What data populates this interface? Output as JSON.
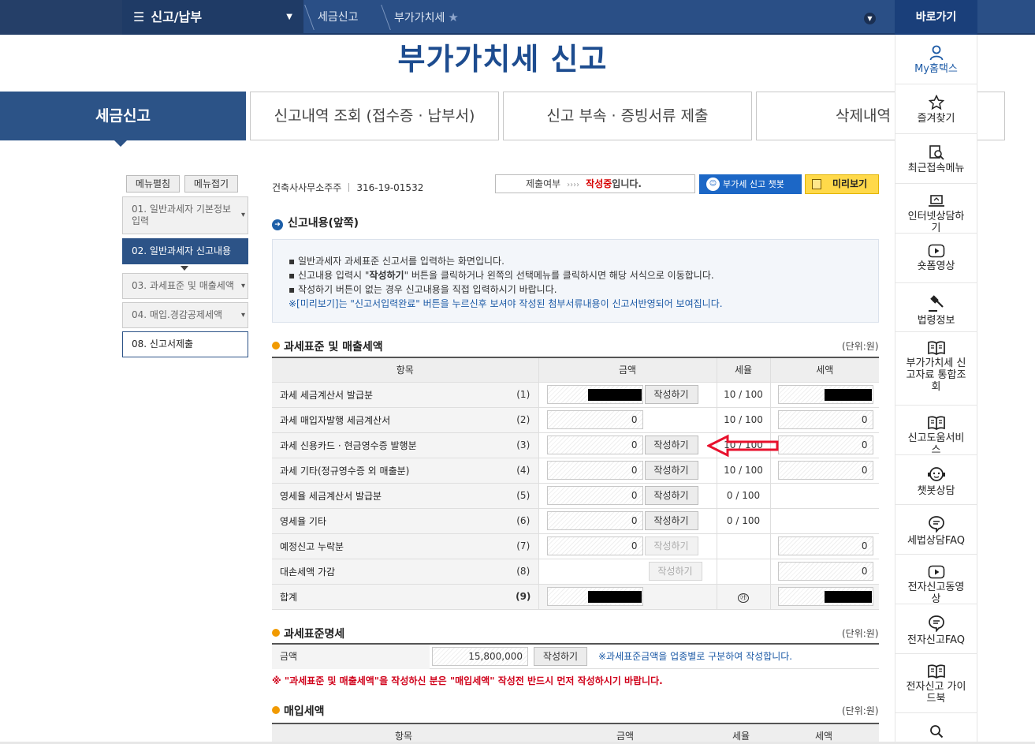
{
  "topbar": {
    "menu_label": "신고/납부",
    "breadcrumb": [
      "세금신고",
      "부가가치세"
    ],
    "quick_title": "바로가기"
  },
  "page_title": "부가가치세 신고",
  "tabs": [
    "세금신고",
    "신고내역 조회 (접수증 · 납부서)",
    "신고 부속 · 증빙서류 제출",
    "삭제내역"
  ],
  "sidebar": {
    "expand_label": "메뉴펼침",
    "collapse_label": "메뉴접기",
    "items": [
      {
        "label": "01. 일반과세자 기본정보 입력"
      },
      {
        "label": "02. 일반과세자 신고내용"
      },
      {
        "label": "03. 과세표준 및 매출세액"
      },
      {
        "label": "04. 매입.경감공제세액"
      },
      {
        "label": "08. 신고서제출"
      }
    ]
  },
  "business": {
    "name": "건축사사무소주주",
    "reg_no": "316-19-01532"
  },
  "status": {
    "label": "제출여부",
    "arrows": "››››",
    "value": "작성중",
    "suffix": "입니다."
  },
  "buttons": {
    "chatbot": "부가세 신고 챗봇",
    "preview": "미리보기",
    "write": "작성하기"
  },
  "section": {
    "title": "신고내용(앞쪽)",
    "info_lines": [
      "▪ 일반과세자 과세표준 신고서를 입력하는 화면입니다.",
      "▪ 신고내용 입력시 \"",
      "작성하기",
      "\" 버튼을 클릭하거나 왼쪽의 선택메뉴를 클릭하시면 해당 서식으로 이동합니다.",
      "▪ 작성하기 버튼이 없는 경우 신고내용을 직접 입력하시기 바랍니다.",
      "※[미리보기]는 \"신고서입력완료\" 버튼을 누르신후 보셔야 작성된 첨부서류내용이 신고서반영되어 보여집니다."
    ]
  },
  "sales": {
    "title": "과세표준 및 매출세액",
    "unit": "(단위:원)",
    "headers": [
      "항목",
      "금액",
      "세율",
      "세액"
    ],
    "rows": [
      {
        "label": "과세 세금계산서 발급분",
        "num": "(1)",
        "amount": "",
        "masked": true,
        "write": "active",
        "rate": "10 / 100",
        "tax": "",
        "tax_masked": true
      },
      {
        "label": "과세 매입자발행 세금계산서",
        "num": "(2)",
        "amount": "0",
        "masked": false,
        "write": "none",
        "rate": "10 / 100",
        "tax": "0",
        "tax_masked": false
      },
      {
        "label": "과세 신용카드 · 현금영수증 발행분",
        "num": "(3)",
        "amount": "0",
        "masked": false,
        "write": "active",
        "rate": "10 / 100",
        "tax": "0",
        "tax_masked": false
      },
      {
        "label": "과세 기타(정규영수증 외 매출분)",
        "num": "(4)",
        "amount": "0",
        "masked": false,
        "write": "active",
        "rate": "10 / 100",
        "tax": "0",
        "tax_masked": false
      },
      {
        "label": "영세율 세금계산서 발급분",
        "num": "(5)",
        "amount": "0",
        "masked": false,
        "write": "active",
        "rate": "0 / 100",
        "tax": "",
        "tax_masked": false,
        "no_tax": true
      },
      {
        "label": "영세율 기타",
        "num": "(6)",
        "amount": "0",
        "masked": false,
        "write": "active",
        "rate": "0 / 100",
        "tax": "",
        "tax_masked": false,
        "no_tax": true
      },
      {
        "label": "예정신고 누락분",
        "num": "(7)",
        "amount": "0",
        "masked": false,
        "write": "disabled",
        "rate": "",
        "tax": "0",
        "tax_masked": false
      },
      {
        "label": "대손세액 가감",
        "num": "(8)",
        "amount": "",
        "masked": false,
        "no_amount": true,
        "write": "disabled",
        "rate": "",
        "tax": "0",
        "tax_masked": false
      }
    ],
    "total": {
      "label": "합계",
      "num": "(9)",
      "rate_symbol": "㉮"
    }
  },
  "base": {
    "title": "과세표준명세",
    "unit": "(단위:원)",
    "label": "금액",
    "amount": "15,800,000",
    "note": "※과세표준금액을 업종별로 구분하여 작성합니다.",
    "warning": "※ \"과세표준 및 매출세액\"을 작성하신 분은 \"매입세액\" 작성전 반드시 먼저 작성하시기 바랍니다."
  },
  "purchase": {
    "title": "매입세액",
    "unit": "(단위:원)",
    "headers": [
      "항목",
      "금액",
      "세율",
      "세액"
    ]
  },
  "quick_menu": [
    {
      "label": "My홈택스",
      "icon": "person-icon"
    },
    {
      "label": "즐겨찾기",
      "icon": "star-icon"
    },
    {
      "label": "최근접속메뉴",
      "icon": "recent-icon"
    },
    {
      "label": "인터넷상담하기",
      "icon": "laptop-icon"
    },
    {
      "label": "숏폼영상",
      "icon": "play-icon"
    },
    {
      "label": "법령정보",
      "icon": "gavel-icon"
    },
    {
      "label": "부가가치세 신고자료 통합조회",
      "icon": "book-icon"
    },
    {
      "label": "신고도움서비스",
      "icon": "book-icon"
    },
    {
      "label": "챗봇상담",
      "icon": "chatbot-icon"
    },
    {
      "label": "세법상담FAQ",
      "icon": "speech-icon"
    },
    {
      "label": "전자신고동영상",
      "icon": "play-icon"
    },
    {
      "label": "전자신고FAQ",
      "icon": "speech-icon"
    },
    {
      "label": "전자신고 가이드북",
      "icon": "book-icon"
    }
  ],
  "colors": {
    "brand": "#2c5387",
    "accent": "#1c67c6",
    "warning": "#d0021b",
    "preview": "#ffd94a"
  }
}
